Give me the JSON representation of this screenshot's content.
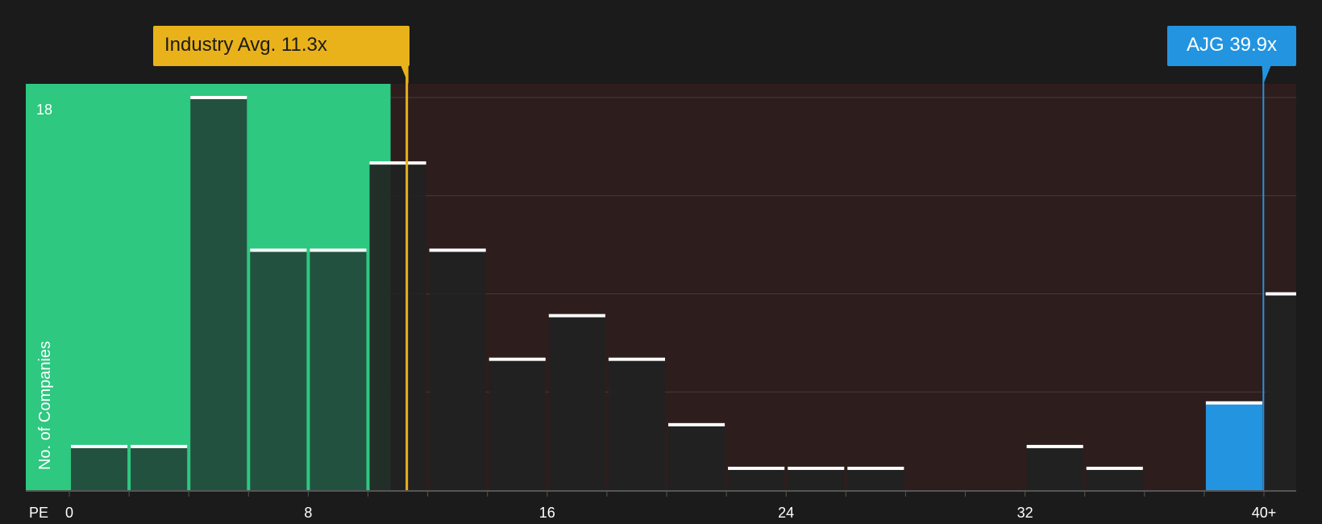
{
  "callouts": {
    "industry": "Industry Avg. 11.3x",
    "company": "AJG 39.9x"
  },
  "colors": {
    "background": "#1b1b1b",
    "undervalued_zone": "#2ec880",
    "overvalued_zone": "#2e1d1d",
    "industry": "#e9b21b",
    "company": "#2394e0",
    "bar_dark": "#222222",
    "bar_green": "#23473a"
  },
  "chart_data": {
    "type": "bar",
    "xlabel": "PE",
    "ylabel": "No. of Companies",
    "xlim": [
      0,
      41
    ],
    "ylim": [
      0,
      18
    ],
    "x_ticks": [
      {
        "value": 0,
        "label": "0"
      },
      {
        "value": 8,
        "label": "8"
      },
      {
        "value": 16,
        "label": "16"
      },
      {
        "value": 24,
        "label": "24"
      },
      {
        "value": 32,
        "label": "32"
      },
      {
        "value": 40,
        "label": "40+"
      }
    ],
    "y_ticks": [
      {
        "value": 18,
        "label": "18"
      }
    ],
    "gridlines": [
      4.5,
      9,
      13.5,
      18
    ],
    "bin_width": 2,
    "bars": [
      {
        "start": 0,
        "value": 2
      },
      {
        "start": 2,
        "value": 2
      },
      {
        "start": 4,
        "value": 18
      },
      {
        "start": 6,
        "value": 11
      },
      {
        "start": 8,
        "value": 11
      },
      {
        "start": 10,
        "value": 15
      },
      {
        "start": 12,
        "value": 11
      },
      {
        "start": 14,
        "value": 6
      },
      {
        "start": 16,
        "value": 8
      },
      {
        "start": 18,
        "value": 6
      },
      {
        "start": 20,
        "value": 3
      },
      {
        "start": 22,
        "value": 1
      },
      {
        "start": 24,
        "value": 1
      },
      {
        "start": 26,
        "value": 1
      },
      {
        "start": 28,
        "value": 0
      },
      {
        "start": 30,
        "value": 0
      },
      {
        "start": 32,
        "value": 2
      },
      {
        "start": 34,
        "value": 1
      },
      {
        "start": 36,
        "value": 0
      },
      {
        "start": 38,
        "value": 4
      },
      {
        "start": 40,
        "value": 9
      }
    ],
    "industry_avg": 11.3,
    "company": {
      "name": "AJG",
      "value": 39.9,
      "bin_start": 38
    }
  }
}
